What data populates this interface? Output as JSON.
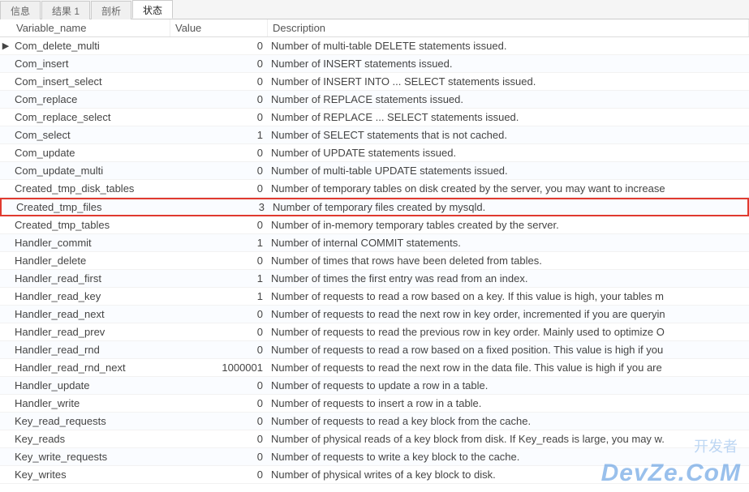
{
  "tabs": [
    {
      "label": "信息",
      "active": false
    },
    {
      "label": "结果 1",
      "active": false
    },
    {
      "label": "剖析",
      "active": false
    },
    {
      "label": "状态",
      "active": true
    }
  ],
  "columns": {
    "name": "Variable_name",
    "value": "Value",
    "desc": "Description"
  },
  "rows": [
    {
      "name": "Com_delete_multi",
      "value": "0",
      "desc": "Number of multi-table DELETE statements issued.",
      "marker": true
    },
    {
      "name": "Com_insert",
      "value": "0",
      "desc": "Number of INSERT statements issued."
    },
    {
      "name": "Com_insert_select",
      "value": "0",
      "desc": "Number of INSERT INTO ... SELECT statements issued."
    },
    {
      "name": "Com_replace",
      "value": "0",
      "desc": "Number of REPLACE statements issued."
    },
    {
      "name": "Com_replace_select",
      "value": "0",
      "desc": "Number of REPLACE ... SELECT statements issued."
    },
    {
      "name": "Com_select",
      "value": "1",
      "desc": "Number of SELECT statements that is not cached."
    },
    {
      "name": "Com_update",
      "value": "0",
      "desc": "Number of UPDATE statements issued."
    },
    {
      "name": "Com_update_multi",
      "value": "0",
      "desc": "Number of multi-table UPDATE statements issued."
    },
    {
      "name": "Created_tmp_disk_tables",
      "value": "0",
      "desc": "Number of temporary tables on disk created by the server, you may want to increase"
    },
    {
      "name": "Created_tmp_files",
      "value": "3",
      "desc": "Number of temporary files created by mysqld.",
      "highlighted": true
    },
    {
      "name": "Created_tmp_tables",
      "value": "0",
      "desc": "Number of in-memory temporary tables created by the server."
    },
    {
      "name": "Handler_commit",
      "value": "1",
      "desc": "Number of internal COMMIT statements."
    },
    {
      "name": "Handler_delete",
      "value": "0",
      "desc": "Number of times that rows have been deleted from tables."
    },
    {
      "name": "Handler_read_first",
      "value": "1",
      "desc": "Number of times the first entry was read from an index."
    },
    {
      "name": "Handler_read_key",
      "value": "1",
      "desc": "Number of requests to read a row based on a key. If this value is high, your tables m"
    },
    {
      "name": "Handler_read_next",
      "value": "0",
      "desc": "Number of requests to read the next row in key order, incremented if you are queryin"
    },
    {
      "name": "Handler_read_prev",
      "value": "0",
      "desc": "Number of requests to read the previous row in key order. Mainly used to optimize O"
    },
    {
      "name": "Handler_read_rnd",
      "value": "0",
      "desc": "Number of requests to read a row based on a fixed position. This value is high if you"
    },
    {
      "name": "Handler_read_rnd_next",
      "value": "1000001",
      "desc": "Number of requests to read the next row in the data file. This value is high if you are"
    },
    {
      "name": "Handler_update",
      "value": "0",
      "desc": "Number of requests to update a row in a table."
    },
    {
      "name": "Handler_write",
      "value": "0",
      "desc": "Number of requests to insert a row in a table."
    },
    {
      "name": "Key_read_requests",
      "value": "0",
      "desc": "Number of requests to read a key block from the cache."
    },
    {
      "name": "Key_reads",
      "value": "0",
      "desc": "Number of physical reads of a key block from disk. If Key_reads is large, you may w."
    },
    {
      "name": "Key_write_requests",
      "value": "0",
      "desc": "Number of requests to write a key block to the cache."
    },
    {
      "name": "Key_writes",
      "value": "0",
      "desc": "Number of physical writes of a key block to disk."
    }
  ],
  "watermark": {
    "sub": "开发者",
    "main": "DevZe.CoM"
  }
}
